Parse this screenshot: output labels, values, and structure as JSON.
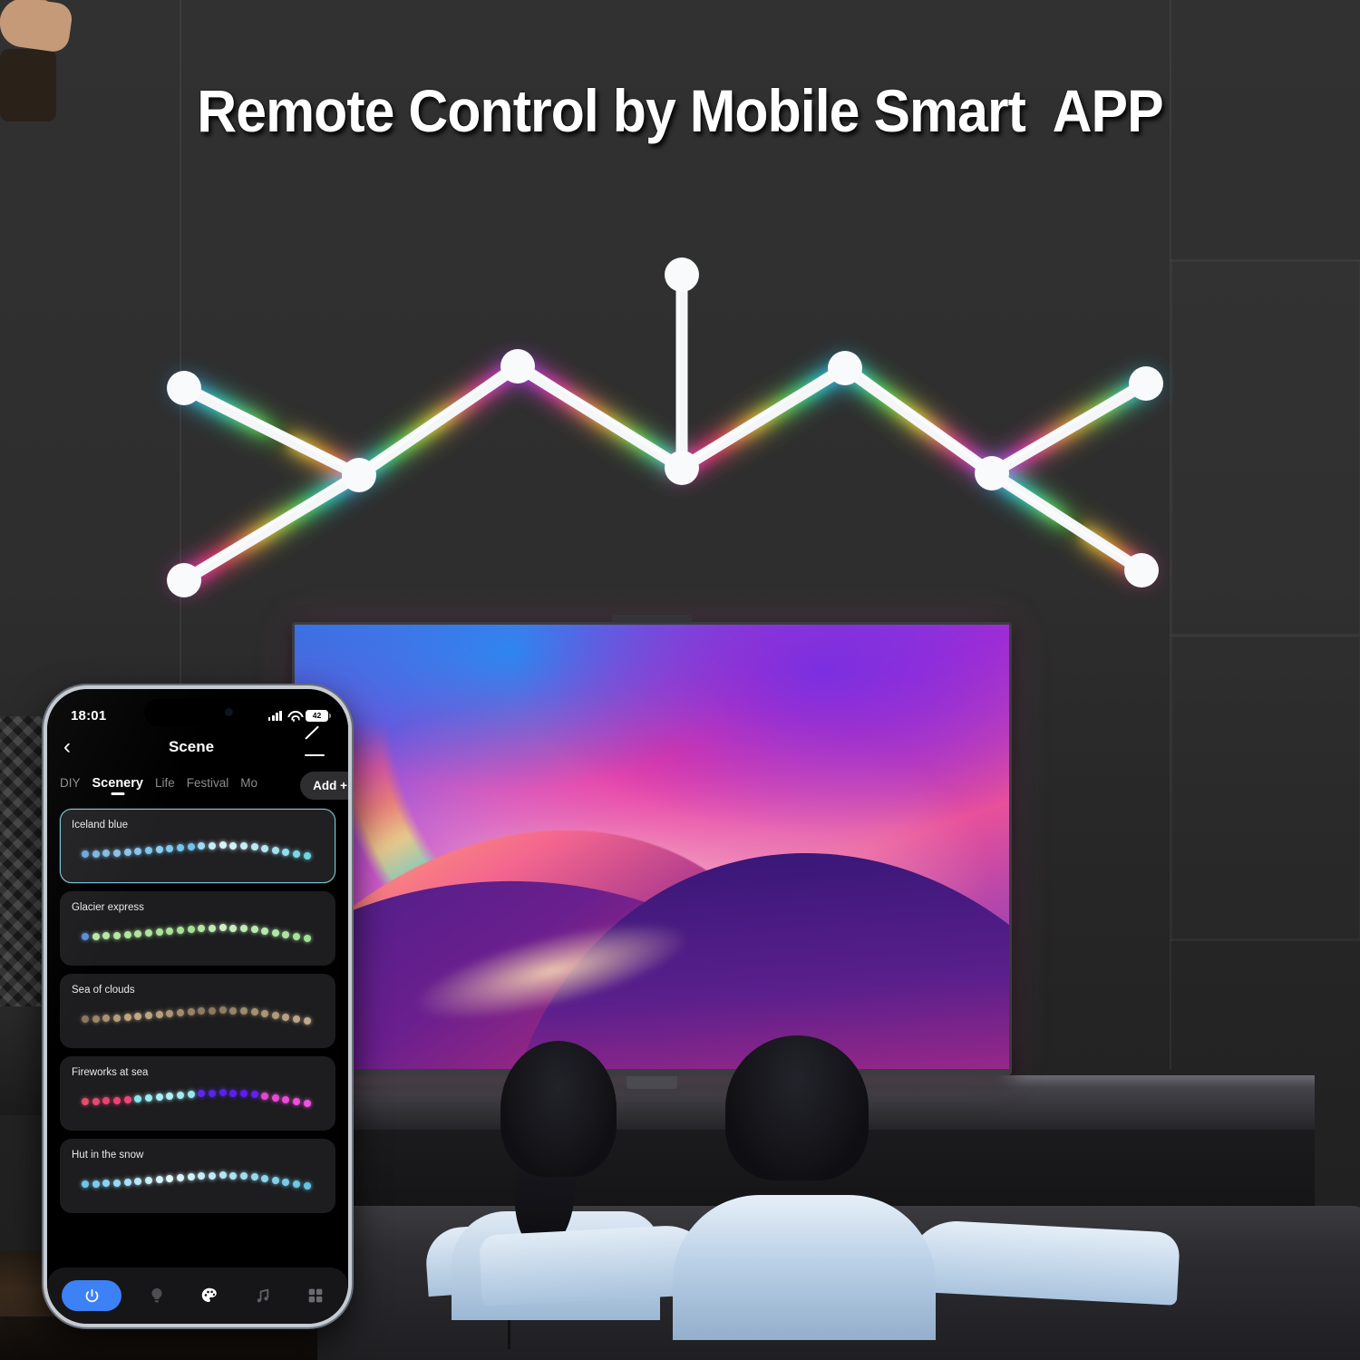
{
  "page": {
    "headline": "Remote Control by Mobile Smart  APP"
  },
  "scene_image": {
    "wall_lights_label": "rgb-wall-light-bars",
    "tv_content_label": "rainbow-dune-wallpaper",
    "people_label": "couple-watching-tv"
  },
  "phone": {
    "status": {
      "time": "18:01",
      "battery": "42",
      "signal_icon": "signal-bars-icon",
      "wifi_icon": "wifi-icon",
      "battery_icon": "battery-icon"
    },
    "nav": {
      "back_icon": "‹",
      "title": "Scene",
      "edit_icon": "pencil-icon"
    },
    "tabs": {
      "items": [
        {
          "label": "DIY",
          "active": false
        },
        {
          "label": "Scenery",
          "active": true
        },
        {
          "label": "Life",
          "active": false
        },
        {
          "label": "Festival",
          "active": false
        },
        {
          "label": "Mo",
          "active": false
        }
      ],
      "add_label": "Add +"
    },
    "scenes": [
      {
        "name": "Iceland blue",
        "selected": true,
        "colors": [
          "#6aa8d8",
          "#7fb6de",
          "#86bbe2",
          "#8cc0e6",
          "#8ec4ea",
          "#87c4ee",
          "#7ec6f0",
          "#8ecdf2",
          "#7fc8f0",
          "#74c6ee",
          "#6fc4ec",
          "#9fdcf4",
          "#c8ecf8",
          "#d8f2fa",
          "#d2f0f8",
          "#c6ecf6",
          "#bce8f4",
          "#b6e6f4",
          "#a4e2f0",
          "#8ee0ee",
          "#7ad9e8",
          "#6fd6e4"
        ]
      },
      {
        "name": "Glacier express",
        "selected": false,
        "colors": [
          "#5a8fd8",
          "#b8e8a8",
          "#b6e8a4",
          "#b4e7a2",
          "#b2e6a0",
          "#b0e59e",
          "#aee49c",
          "#ace39a",
          "#aae298",
          "#a8e196",
          "#a6e094",
          "#b4e6a4",
          "#c2ecb6",
          "#cdf0c4",
          "#c8eec0",
          "#c0ecb8",
          "#bae9b0",
          "#b6e8ac",
          "#b0e6a6",
          "#abe4a0",
          "#a6e29a",
          "#a0e094"
        ]
      },
      {
        "name": "Sea of clouds",
        "selected": false,
        "colors": [
          "#8a7560",
          "#9a8468",
          "#a89170",
          "#b49c78",
          "#bca47e",
          "#c0a882",
          "#bda580",
          "#b6a07c",
          "#ac9676",
          "#a28c70",
          "#97836a",
          "#8d7a64",
          "#8a785f",
          "#8f7d63",
          "#968468",
          "#9d8a6d",
          "#a49072",
          "#aa9677",
          "#b09b7c",
          "#b6a081",
          "#bba586",
          "#c0aa8b"
        ]
      },
      {
        "name": "Fireworks at sea",
        "selected": false,
        "colors": [
          "#e0506c",
          "#e44a70",
          "#e84470",
          "#ec4472",
          "#ef4676",
          "#8de4ee",
          "#9ceaf2",
          "#a8eef4",
          "#b0f0f6",
          "#a4ecf2",
          "#96e8f0",
          "#5a2ae8",
          "#5526ea",
          "#5822ec",
          "#5a20ee",
          "#5c1ef0",
          "#6020f2",
          "#e048d0",
          "#e44ad2",
          "#e84cd6",
          "#ec50da",
          "#f054de"
        ]
      },
      {
        "name": "Hut in the snow",
        "selected": false,
        "colors": [
          "#6fc4ec",
          "#7ccaef",
          "#8ad2f2",
          "#9ad9f4",
          "#a8e0f6",
          "#b8e8f8",
          "#c8eefa",
          "#d6f4fc",
          "#e0f7fd",
          "#dcf5fc",
          "#d2f1fa",
          "#c8edf8",
          "#bee9f6",
          "#b4e5f4",
          "#aae1f2",
          "#a0ddf0",
          "#96d9ee",
          "#8cd5ec",
          "#82d1ea",
          "#78cde8",
          "#6ec9e6",
          "#64c5e4"
        ]
      }
    ],
    "bottom_bar": {
      "items": [
        {
          "name": "power-button",
          "icon": "power-icon",
          "active": true
        },
        {
          "name": "bulb-button",
          "icon": "bulb-icon",
          "active": false
        },
        {
          "name": "palette-button",
          "icon": "palette-icon",
          "active": true
        },
        {
          "name": "music-button",
          "icon": "music-note-icon",
          "active": false
        },
        {
          "name": "grid-button",
          "icon": "grid-icon",
          "active": false
        }
      ]
    }
  },
  "colors": {
    "accent_blue": "#3d81f6",
    "selected_border": "#79c6d8",
    "card_bg": "#1d1d1f",
    "phone_bg": "#000000"
  }
}
